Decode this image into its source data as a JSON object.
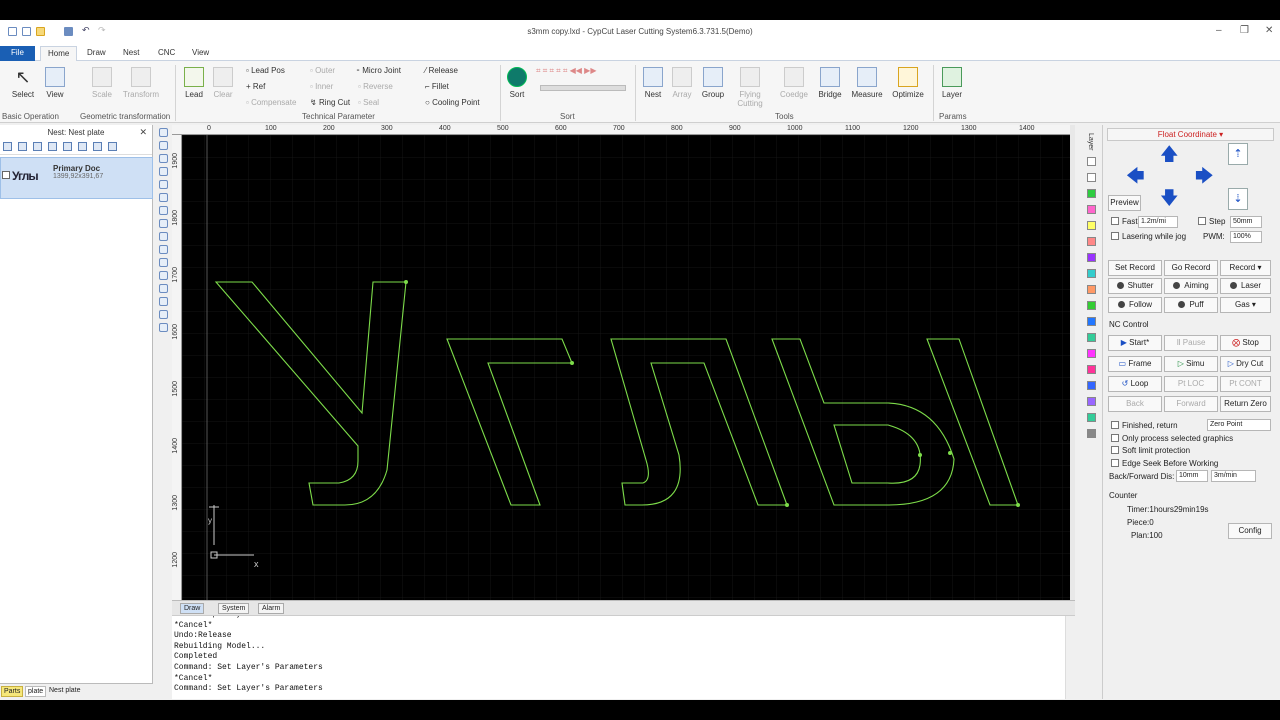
{
  "window": {
    "title": "s3mm copy.lxd - CypCut Laser Cutting System6.3.731.5(Demo)"
  },
  "menu": {
    "file": "File",
    "tabs": [
      "Home",
      "Draw",
      "Nest",
      "CNC",
      "View"
    ]
  },
  "ribbon": {
    "select": "Select",
    "view": "View",
    "scale": "Scale",
    "transform": "Transform",
    "lead": "Lead",
    "clear": "Clear",
    "lead_pos": "Lead Pos",
    "ref": "Ref",
    "compensate": "Compensate",
    "outer": "Outer",
    "inner": "Inner",
    "reverse": "Reverse",
    "seal": "Seal",
    "micro_joint": "Micro Joint",
    "ring_cut": "Ring Cut",
    "release": "Release",
    "fillet": "Fillet",
    "cooling_point": "Cooling Point",
    "sort": "Sort",
    "nest": "Nest",
    "array": "Array",
    "group": "Group",
    "flying_cutting": "Flying Cutting",
    "coedge": "Coedge",
    "bridge": "Bridge",
    "measure": "Measure",
    "optimize": "Optimize",
    "layer": "Layer",
    "groups": {
      "basic": "Basic Operation",
      "geo": "Geometric transformation",
      "tech": "Technical Parameter",
      "sort": "Sort",
      "tools": "Tools",
      "params": "Params"
    }
  },
  "left": {
    "header": "Nest: Nest plate",
    "doc_name": "Primary Doc",
    "doc_size": "1399,92x391,67",
    "doc_label": "Углы",
    "tabs": [
      "Parts",
      "plate",
      "Nest plate"
    ]
  },
  "ruler": {
    "h": [
      "0",
      "100",
      "200",
      "300",
      "400",
      "500",
      "600",
      "700",
      "800",
      "900",
      "1000",
      "1100",
      "1200",
      "1300",
      "1400"
    ],
    "v": [
      "1900",
      "1800",
      "1700",
      "1600",
      "1500",
      "1400",
      "1300",
      "1200"
    ]
  },
  "canvas": {
    "axis_x": "x",
    "axis_y": "y",
    "text": "Углы"
  },
  "bottom_tabs": [
    "Draw",
    "System",
    "Alarm"
  ],
  "console": [
    "Please specify location:",
    "*Cancel*",
    "Undo:Release",
    "Rebuilding Model...",
    "Completed",
    "Command: Set Layer's Parameters",
    "*Cancel*",
    "Command: Set Layer's Parameters"
  ],
  "right": {
    "layer_tab": "Layer",
    "coord_mode": "Float Coordinate",
    "preview": "Preview",
    "fast": "Fast",
    "fast_val": "1.2m/mi",
    "step": "Step",
    "step_val": "50mm",
    "lasering_jog": "Lasering while jog",
    "pwm": "PWM:",
    "pwm_val": "100%",
    "set_record": "Set Record",
    "go_record": "Go Record",
    "record": "Record",
    "shutter": "Shutter",
    "aiming": "Aiming",
    "laser": "Laser",
    "follow": "Follow",
    "puff": "Puff",
    "gas": "Gas",
    "nc_control": "NC Control",
    "start": "Start*",
    "pause": "Pause",
    "stop": "Stop",
    "frame": "Frame",
    "simu": "Simu",
    "dry_cut": "Dry Cut",
    "loop": "Loop",
    "pt_loc": "Pt LOC",
    "pt_cont": "Pt CONT",
    "back": "Back",
    "forward": "Forward",
    "return_zero": "Return Zero",
    "finished_return": "Finished, return",
    "zero_point": "Zero Point",
    "only_selected": "Only process selected graphics",
    "soft_limit": "Soft limit protection",
    "edge_seek": "Edge Seek Before Working",
    "bf_dis": "Back/Forward Dis:",
    "bf_val1": "10mm",
    "bf_val2": "3m/min",
    "counter": "Counter",
    "timer": "Timer:1hours29min19s",
    "piece": "Piece:0",
    "plan": "Plan:100",
    "config": "Config"
  },
  "colors": {
    "path": "#7ddc4a",
    "accent": "#1a5fb4",
    "warn": "#cc2222"
  }
}
